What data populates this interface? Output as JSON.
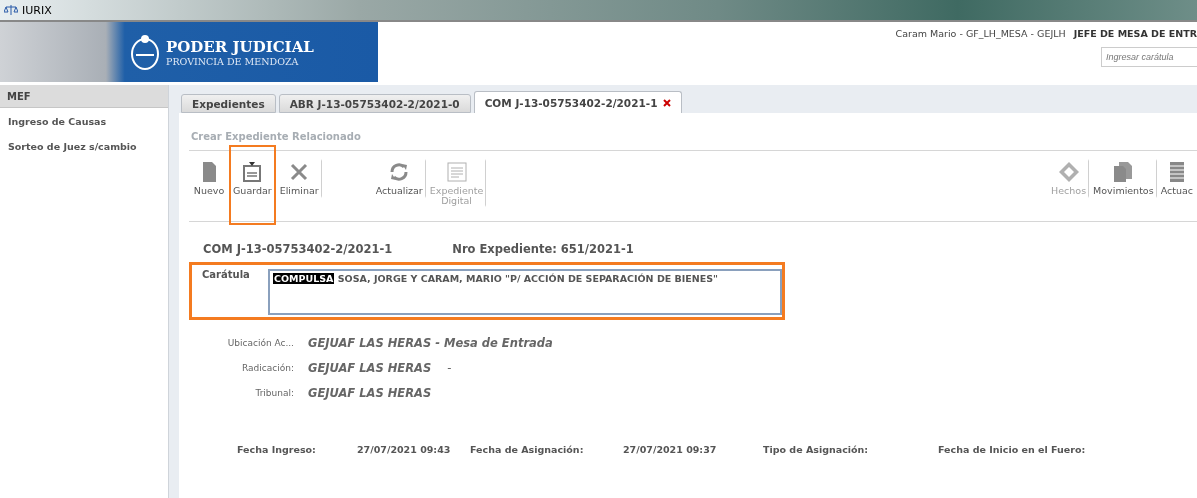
{
  "window": {
    "title": "IURIX"
  },
  "header": {
    "brand_title": "PODER JUDICIAL",
    "brand_subtitle": "PROVINCIA DE MENDOZA",
    "user": "Caram Mario - GF_LH_MESA - GEJLH",
    "role": "JEFE DE MESA DE ENTR",
    "search": {
      "placeholder": "Ingresar carátula"
    }
  },
  "sidebar": {
    "title": "MEF",
    "items": [
      {
        "label": "Ingreso de Causas",
        "selected": false
      },
      {
        "label": "Sorteo de Juez s/cambio",
        "selected": false
      }
    ]
  },
  "tabs": [
    {
      "label": "Expedientes",
      "selected": false,
      "closable": false
    },
    {
      "label": "ABR  J-13-05753402-2/2021-0",
      "selected": false,
      "closable": false
    },
    {
      "label": "COM  J-13-05753402-2/2021-1",
      "selected": true,
      "closable": true
    }
  ],
  "action_link": "Crear Expediente Relacionado",
  "toolbar_left": [
    {
      "kind": "file",
      "label": "Nuevo",
      "disabled": false,
      "highlighted": false
    },
    {
      "kind": "save",
      "label": "Guardar",
      "disabled": false,
      "highlighted": true
    },
    {
      "kind": "delete",
      "label": "Eliminar",
      "disabled": false,
      "highlighted": false
    },
    {
      "kind": "refresh",
      "label": "Actualizar",
      "disabled": false,
      "highlighted": false
    },
    {
      "kind": "document",
      "label": "Expediente Digital",
      "disabled": true,
      "highlighted": false
    }
  ],
  "toolbar_right": [
    {
      "kind": "diamond",
      "label": "Hechos",
      "disabled": true,
      "highlighted": false
    },
    {
      "kind": "files",
      "label": "Movimientos",
      "disabled": false,
      "highlighted": false
    },
    {
      "kind": "list",
      "label": "Actuac",
      "disabled": false,
      "highlighted": false
    }
  ],
  "record": {
    "code": "COM  J-13-05753402-2/2021-1",
    "number": "Nro Expediente: 651/2021-1"
  },
  "caratula": {
    "label": "Carátula",
    "tag": "COMPULSA",
    "value": "SOSA, JORGE  Y CARAM, MARIO \"P/  ACCIÓN DE SEPARACIÓN DE BIENES\"",
    "highlighted": true
  },
  "details": [
    {
      "label": "Ubicación Ac...",
      "value": "GEJUAF LAS HERAS - Mesa de Entrada"
    },
    {
      "label": "Radicación:",
      "value": "GEJUAF LAS HERAS",
      "suffix": "-"
    },
    {
      "label": "Tribunal:",
      "value": "GEJUAF LAS HERAS"
    }
  ],
  "dates": [
    {
      "label": "Fecha Ingreso:",
      "value": "27/07/2021 09:43"
    },
    {
      "label": "Fecha de Asignación:",
      "value": "27/07/2021 09:37"
    },
    {
      "label": "Tipo de Asignación:"
    },
    {
      "label": "Fecha de Inicio en el Fuero:"
    }
  ]
}
